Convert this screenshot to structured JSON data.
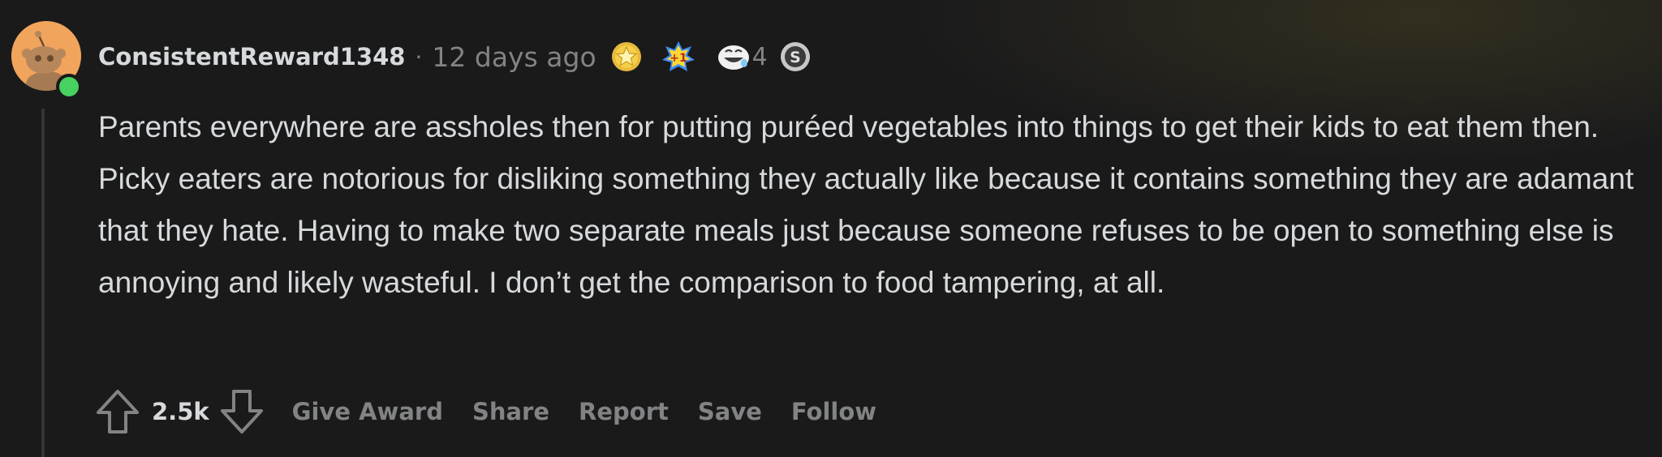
{
  "comment": {
    "author": "ConsistentReward1348",
    "separator": "·",
    "time_ago": "12 days ago",
    "avatar_icon": "snoo-avatar-icon",
    "online_status_color": "#46d160",
    "awards": [
      {
        "icon": "gold-medal-award-icon"
      },
      {
        "icon": "plus-one-award-icon"
      },
      {
        "icon": "rolling-laugh-award-icon",
        "count": "4"
      },
      {
        "icon": "silver-coin-award-icon"
      }
    ],
    "body": "Parents everywhere are assholes then for putting puréed vegetables into things to get their kids to eat them then. Picky eaters are notorious for disliking something they actually like because it contains something they are adamant that they hate. Having to make two separate meals just because someone refuses to be open to something else is annoying and likely wasteful. I don’t get the comparison to food tampering, at all."
  },
  "actions": {
    "score": "2.5k",
    "upvote_icon": "upvote-arrow-icon",
    "downvote_icon": "downvote-arrow-icon",
    "give_award": "Give Award",
    "share": "Share",
    "report": "Report",
    "save": "Save",
    "follow": "Follow"
  }
}
